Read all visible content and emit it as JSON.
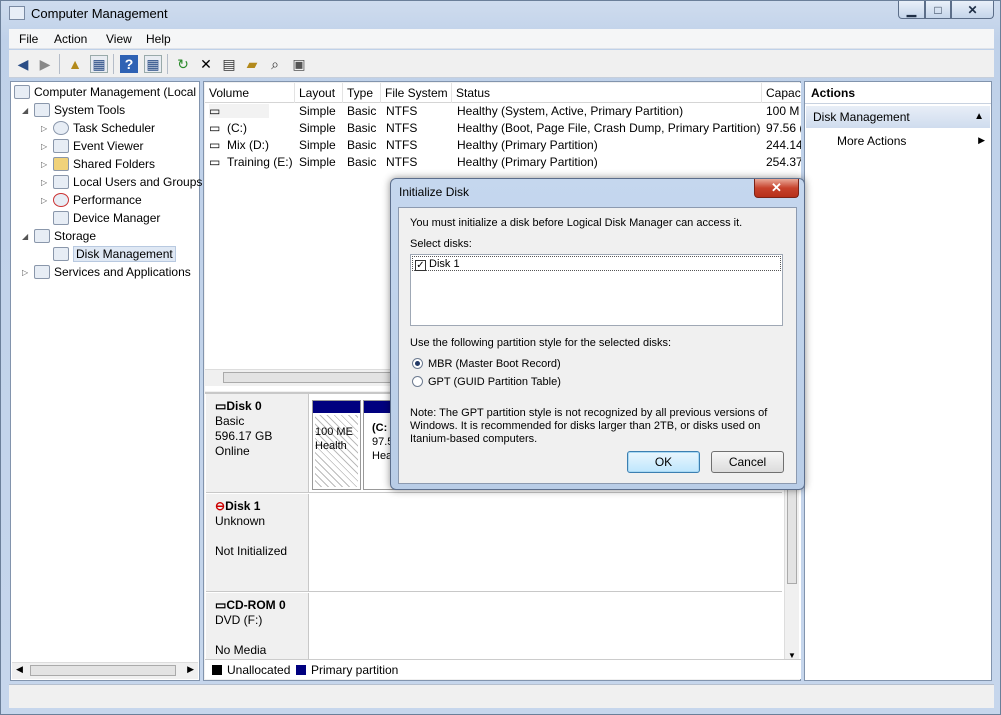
{
  "window": {
    "title": "Computer Management"
  },
  "menu": [
    "File",
    "Action",
    "View",
    "Help"
  ],
  "tree": {
    "root": "Computer Management (Local",
    "system_tools": "System Tools",
    "task_scheduler": "Task Scheduler",
    "event_viewer": "Event Viewer",
    "shared_folders": "Shared Folders",
    "local_users": "Local Users and Groups",
    "performance": "Performance",
    "device_manager": "Device Manager",
    "storage": "Storage",
    "disk_management": "Disk Management",
    "services": "Services and Applications"
  },
  "volumes": {
    "headers": [
      "Volume",
      "Layout",
      "Type",
      "File System",
      "Status",
      "Capac"
    ],
    "rows": [
      [
        "",
        "Simple",
        "Basic",
        "NTFS",
        "Healthy (System, Active, Primary Partition)",
        "100 M"
      ],
      [
        "(C:)",
        "Simple",
        "Basic",
        "NTFS",
        "Healthy (Boot, Page File, Crash Dump, Primary Partition)",
        "97.56 ("
      ],
      [
        "Mix (D:)",
        "Simple",
        "Basic",
        "NTFS",
        "Healthy (Primary Partition)",
        "244.14"
      ],
      [
        "Training (E:)",
        "Simple",
        "Basic",
        "NTFS",
        "Healthy (Primary Partition)",
        "254.37"
      ]
    ]
  },
  "disks": {
    "disk0": {
      "name": "Disk 0",
      "type": "Basic",
      "size": "596.17 GB",
      "state": "Online",
      "p1_size": "100 ME",
      "p1_status": "Health",
      "p2_label": "(C:",
      "p2_size": "97.5(",
      "p2_status": "Hea"
    },
    "disk1": {
      "name": "Disk 1",
      "type": "Unknown",
      "state": "Not Initialized"
    },
    "cdrom": {
      "name": "CD-ROM 0",
      "type": "DVD (F:)",
      "state": "No Media"
    }
  },
  "legend": {
    "unallocated": "Unallocated",
    "primary": "Primary partition"
  },
  "actions": {
    "header": "Actions",
    "section": "Disk Management",
    "more": "More Actions"
  },
  "dialog": {
    "title": "Initialize Disk",
    "intro": "You must initialize a disk before Logical Disk Manager can access it.",
    "select_label": "Select disks:",
    "disk_item": "Disk 1",
    "style_label": "Use the following partition style for the selected disks:",
    "mbr": "MBR (Master Boot Record)",
    "gpt": "GPT (GUID Partition Table)",
    "note1": "Note: The GPT partition style is not recognized by all previous versions of",
    "note2": "Windows. It is recommended for disks larger than 2TB, or disks used on",
    "note3": "Itanium-based computers.",
    "ok": "OK",
    "cancel": "Cancel"
  },
  "colors": {
    "primary_partition": "#00007f",
    "unallocated": "#000000"
  }
}
